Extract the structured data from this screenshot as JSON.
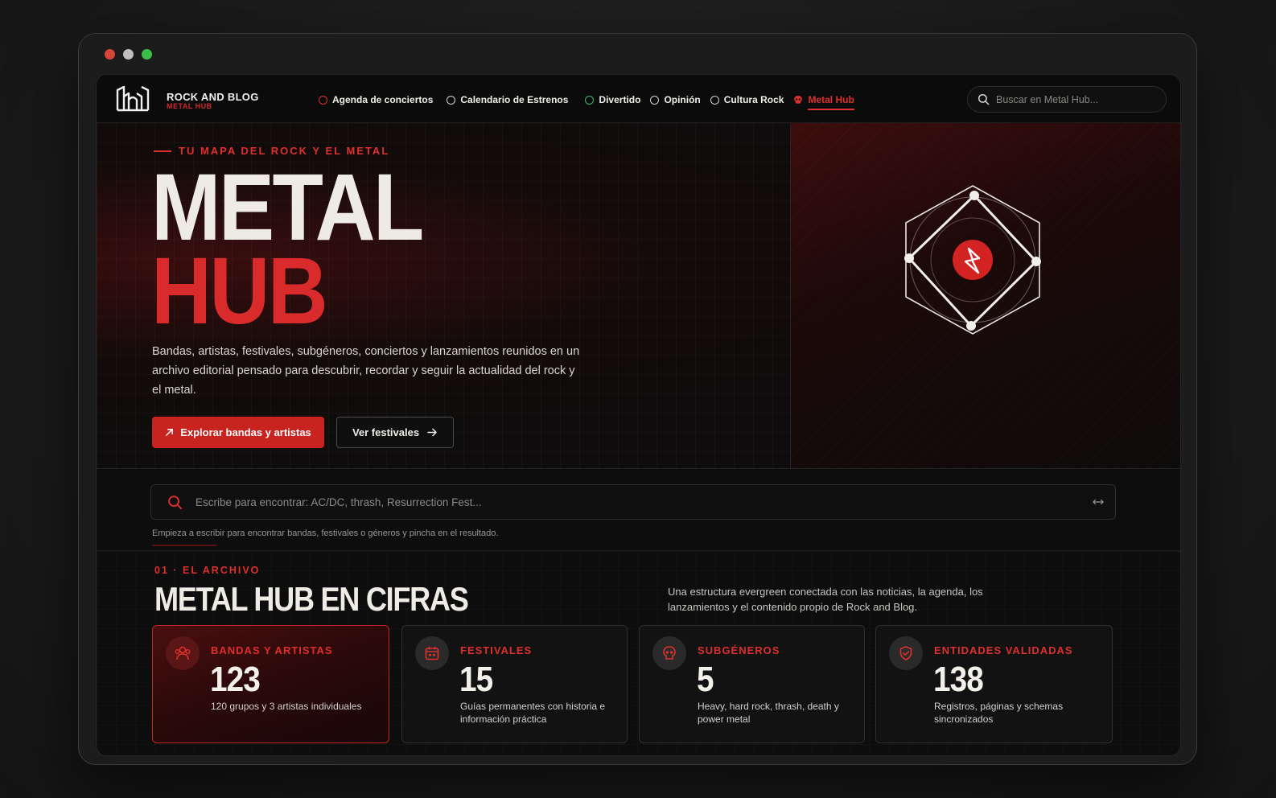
{
  "brand": {
    "name": "ROCK AND BLOG",
    "sub": "METAL HUB"
  },
  "nav": {
    "items": [
      {
        "label": "Agenda de conciertos",
        "icon": "ring-icon",
        "color": "#e0302c"
      },
      {
        "label": "Calendario de Estrenos",
        "icon": "ring-icon",
        "color": "#d8d5d0"
      },
      {
        "label": "Divertido",
        "icon": "ring-icon",
        "color": "#3cbf6a"
      },
      {
        "label": "Opinión",
        "icon": "ring-icon",
        "color": "#d8d5d0"
      },
      {
        "label": "Cultura Rock",
        "icon": "ring-icon",
        "color": "#d8d5d0"
      },
      {
        "label": "Metal Hub",
        "icon": "skull-icon",
        "color": "#e0302c",
        "active": true
      }
    ],
    "search_placeholder": "Buscar en Metal Hub..."
  },
  "hero": {
    "eyebrow": "TU MAPA DEL ROCK Y EL METAL",
    "title_line1": "METAL",
    "title_line2": "HUB",
    "description": "Bandas, artistas, festivales, subgéneros, conciertos y lanzamientos reunidos en un archivo editorial pensado para descubrir, recordar y seguir la actualidad del rock y el metal.",
    "primary_button": "Explorar bandas y artistas",
    "secondary_button": "Ver festivales"
  },
  "finder": {
    "placeholder": "Escribe para encontrar: AC/DC, thrash, Resurrection Fest...",
    "hint": "Empieza a escribir para encontrar bandas, festivales o géneros y pincha en el resultado."
  },
  "stats": {
    "eyebrow": "01 · EL ARCHIVO",
    "title": "METAL HUB EN CIFRAS",
    "description": "Una estructura evergreen conectada con las noticias, la agenda, los lanzamientos y el contenido propio de Rock and Blog.",
    "cards": [
      {
        "label": "BANDAS Y ARTISTAS",
        "value": "123",
        "text": "120 grupos y 3 artistas individuales",
        "icon": "users-icon"
      },
      {
        "label": "FESTIVALES",
        "value": "15",
        "text": "Guías permanentes con historia e información práctica",
        "icon": "calendar-icon"
      },
      {
        "label": "SUBGÉNEROS",
        "value": "5",
        "text": "Heavy, hard rock, thrash, death y power metal",
        "icon": "skull-icon"
      },
      {
        "label": "ENTIDADES VALIDADAS",
        "value": "138",
        "text": "Registros, páginas y schemas sincronizados",
        "icon": "shield-check-icon"
      }
    ]
  },
  "colors": {
    "accent": "#d92b2b",
    "background": "#0d0d0e"
  }
}
